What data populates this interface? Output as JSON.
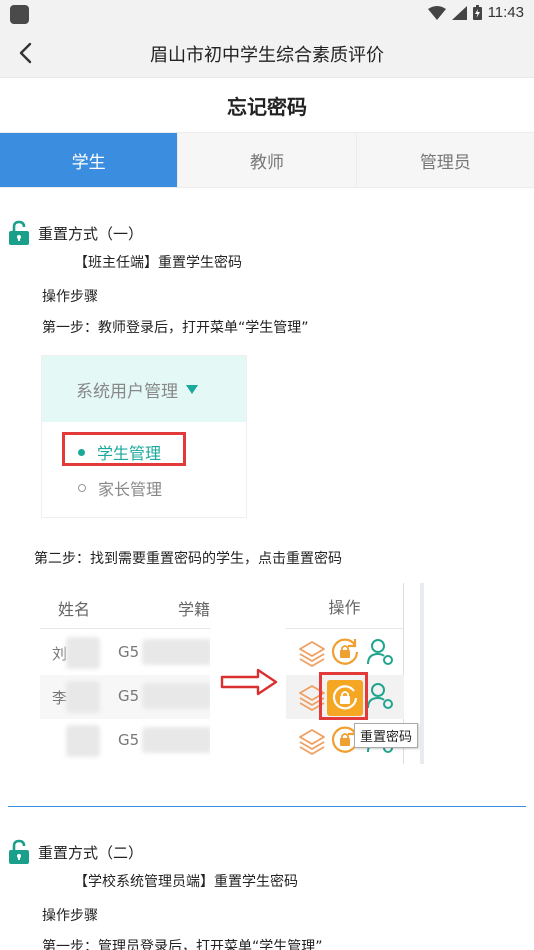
{
  "status_bar": {
    "time": "11:43"
  },
  "app_bar": {
    "title": "眉山市初中学生综合素质评价"
  },
  "page": {
    "title": "忘记密码"
  },
  "tabs": [
    {
      "label": "学生",
      "active": true
    },
    {
      "label": "教师",
      "active": false
    },
    {
      "label": "管理员",
      "active": false
    }
  ],
  "method1": {
    "title": "重置方式（一）",
    "subtitle": "【班主任端】重置学生密码",
    "steps_label": "操作步骤",
    "step1": "第一步：教师登录后，打开菜单“学生管理”",
    "step2": "第二步：找到需要重置密码的学生，点击重置密码",
    "menu_shot": {
      "header": "系统用户管理",
      "items": [
        "学生管理",
        "家长管理"
      ]
    },
    "table_shot": {
      "col_name": "姓名",
      "col_id": "学籍",
      "col_ops": "操作",
      "rows": [
        {
          "name": "刘",
          "id": "G5"
        },
        {
          "name": "李",
          "id": "G5"
        },
        {
          "name": "",
          "id": "G5"
        }
      ],
      "tooltip": "重置密码"
    }
  },
  "method2": {
    "title": "重置方式（二）",
    "subtitle": "【学校系统管理员端】重置学生密码",
    "steps_label": "操作步骤",
    "step1": "第一步：管理员登录后，打开菜单“学生管理”"
  },
  "colors": {
    "accent": "#3b8de0",
    "lock_green": "#1aa08a",
    "menu_teal": "#1aa89a",
    "highlight_red": "#e23a3a",
    "orange": "#f0a030"
  }
}
